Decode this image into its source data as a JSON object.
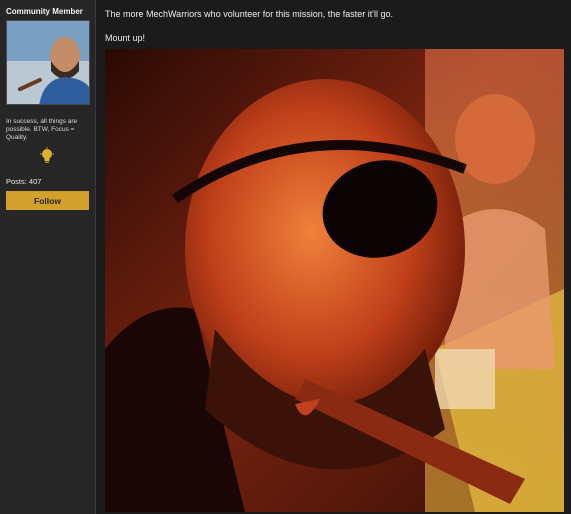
{
  "author": {
    "role": "Community Member",
    "signature": "In success, all things are possible. BTW, Focus = Quality.",
    "posts_label": "Posts: 407",
    "follow_label": "Follow"
  },
  "post": {
    "paragraphs": [
      "The more MechWarriors who volunteer for this mission, the faster it'll go.",
      "Mount up!"
    ]
  },
  "icons": {
    "achievement": "lightbulb-icon"
  },
  "colors": {
    "follow_button": "#d1a12a",
    "sidebar_bg": "#262626",
    "page_bg": "#1b1b1b"
  }
}
